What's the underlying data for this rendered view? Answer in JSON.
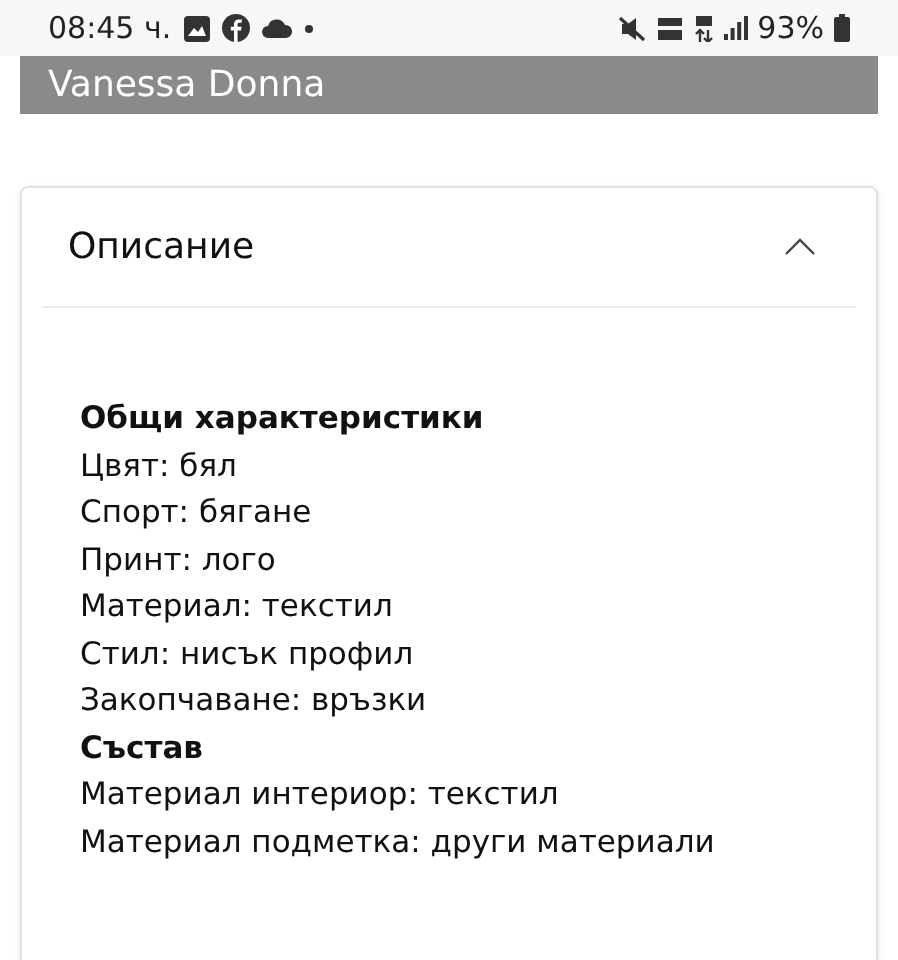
{
  "status_bar": {
    "time": "08:45 ч.",
    "battery": "93%"
  },
  "product_banner": {
    "title": "Vanessa Donna"
  },
  "description_panel": {
    "title": "Описание",
    "expanded": true,
    "lines": [
      {
        "kind": "heading",
        "text": "Общи характеристики"
      },
      {
        "kind": "line",
        "text": "Цвят: бял"
      },
      {
        "kind": "line",
        "text": "Спорт: бягане"
      },
      {
        "kind": "line",
        "text": "Принт: лого"
      },
      {
        "kind": "line",
        "text": "Материал: текстил"
      },
      {
        "kind": "line",
        "text": "Стил: нисък профил"
      },
      {
        "kind": "line",
        "text": "Закопчаване: връзки"
      },
      {
        "kind": "heading",
        "text": "Състав"
      },
      {
        "kind": "line",
        "text": "Материал интериор: текстил"
      },
      {
        "kind": "line",
        "text": "Материал подметка: други материали"
      }
    ]
  }
}
